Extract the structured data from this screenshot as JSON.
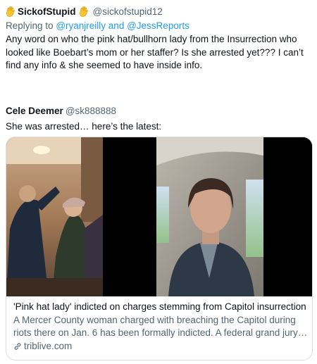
{
  "tweet1": {
    "display_name": "SickofStupid",
    "handle": "@sickofstupid12",
    "reply_prefix": "Replying to",
    "reply_to_1": "@ryanjreilly",
    "reply_and": "and",
    "reply_to_2": "@JessReports",
    "text": "Any word on who the pink hat/bullhorn lady from the Insurrection who looked like Boebart’s mom or her staffer? Is she arrested yet??? I can’t find any info & she seemed to have inside info."
  },
  "tweet2": {
    "display_name": "Cele Deemer",
    "handle": "@sk888888",
    "text": "She was arrested… here’s the latest:"
  },
  "card": {
    "title": "'Pink hat lady' indicted on charges stemming from Capitol insurrection",
    "description": "A Mercer County woman charged with breaching the Capitol during riots there on Jan. 6 has been formally indicted. A federal grand jury…",
    "domain": "triblive.com"
  },
  "colors": {
    "link": "#1d9bf0",
    "secondary_text": "#536471",
    "primary_text": "#0f1419",
    "card_border": "#d9dde1"
  },
  "icons": [
    "raised-hand-icon",
    "link-icon"
  ]
}
